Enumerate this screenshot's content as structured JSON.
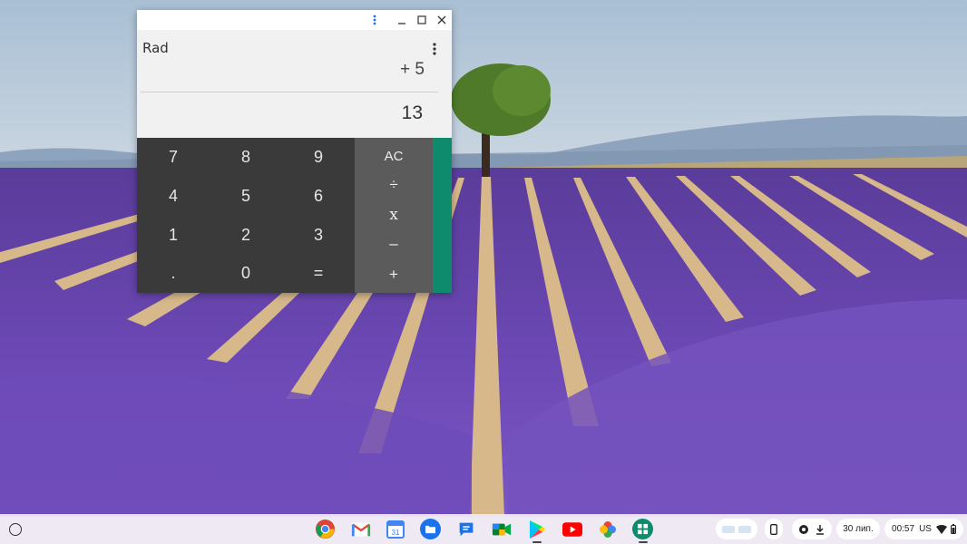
{
  "calculator": {
    "angle_mode": "Rad",
    "formula": "+ 5",
    "result": "13",
    "keys": {
      "row1": [
        "7",
        "8",
        "9"
      ],
      "row2": [
        "4",
        "5",
        "6"
      ],
      "row3": [
        "1",
        "2",
        "3"
      ],
      "row4": [
        ".",
        "0",
        "="
      ]
    },
    "operators": [
      "AC",
      "÷",
      "x",
      "–",
      "+"
    ],
    "accent_color": "#0d8b6c"
  },
  "shelf": {
    "apps": [
      "chrome-icon",
      "gmail-icon",
      "calendar-icon",
      "files-icon",
      "messages-icon",
      "meet-icon",
      "play-store-icon",
      "youtube-icon",
      "photos-icon",
      "calculator-icon"
    ],
    "date": "30 лип.",
    "time": "00:57",
    "keyboard_layout": "US"
  }
}
